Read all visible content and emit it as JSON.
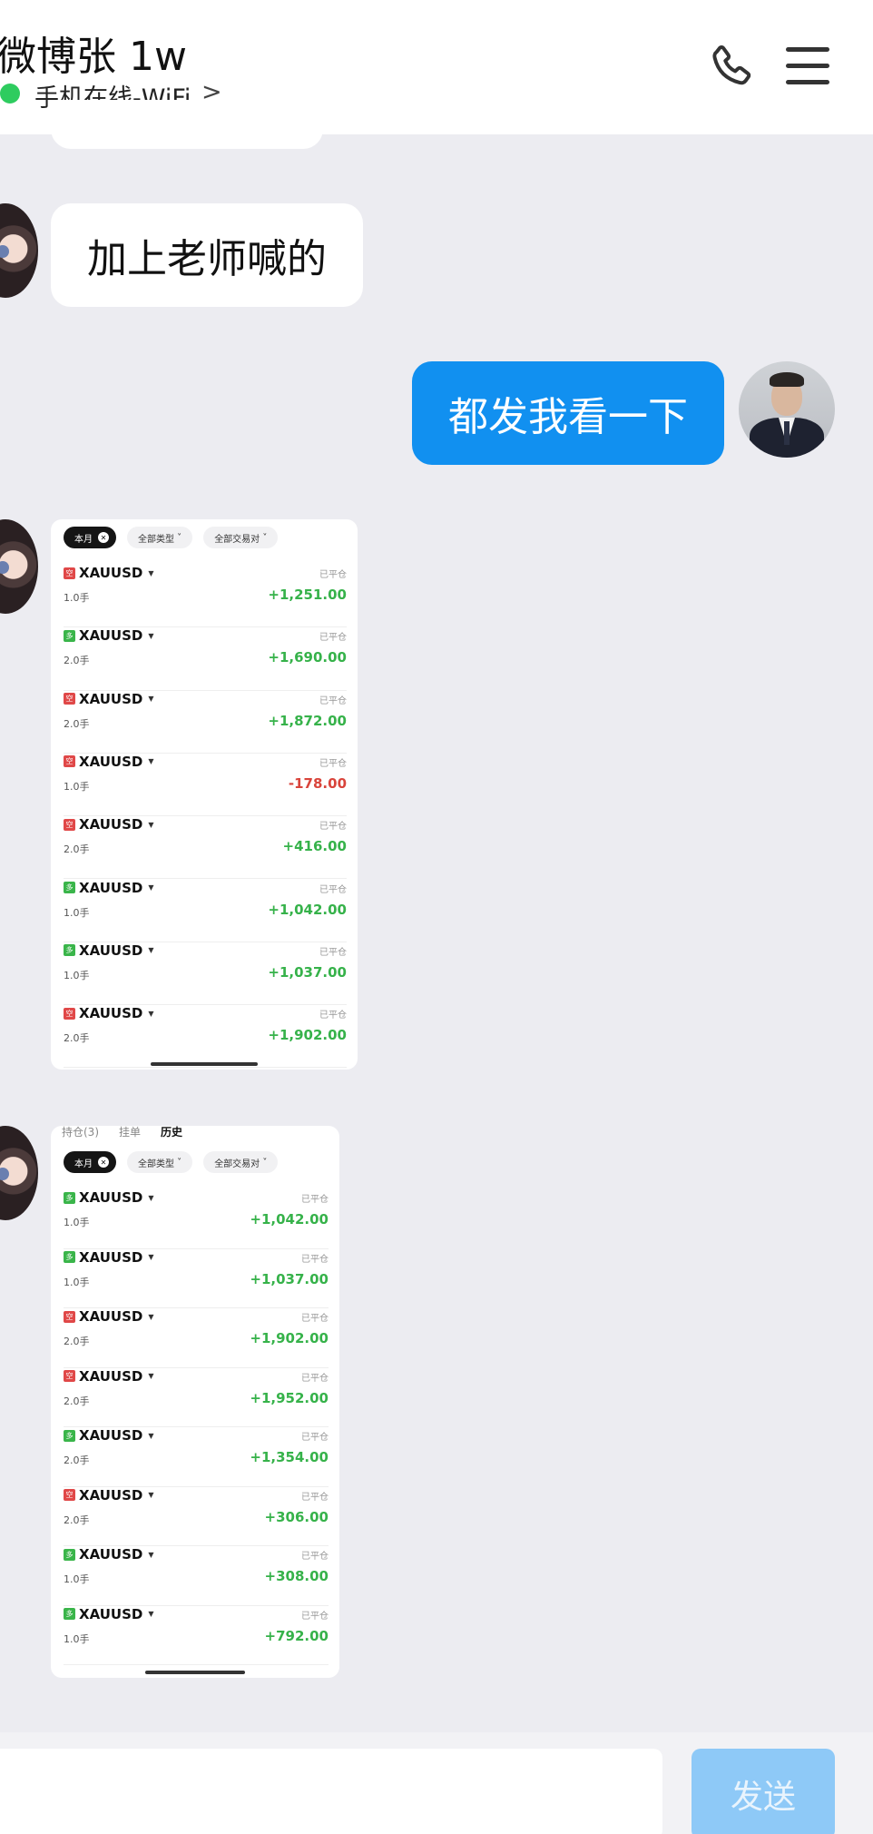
{
  "header": {
    "chat_name": "微博张 1w",
    "status": "手机在线-WiFi",
    "status_chevron": ">",
    "icons": {
      "call": "phone-icon",
      "menu": "menu-icon"
    }
  },
  "messages": {
    "incoming_text": "加上老师喊的",
    "outgoing_text": "都发我看一下"
  },
  "screenshot1": {
    "chips": {
      "month": "本月",
      "type": "全部类型",
      "pair": "全部交易对"
    },
    "trades": [
      {
        "side": "空",
        "symbol": "XAUUSD",
        "lots": "1.0手",
        "status": "已平仓",
        "pnl": "+1,251.00"
      },
      {
        "side": "多",
        "symbol": "XAUUSD",
        "lots": "2.0手",
        "status": "已平仓",
        "pnl": "+1,690.00"
      },
      {
        "side": "空",
        "symbol": "XAUUSD",
        "lots": "2.0手",
        "status": "已平仓",
        "pnl": "+1,872.00"
      },
      {
        "side": "空",
        "symbol": "XAUUSD",
        "lots": "1.0手",
        "status": "已平仓",
        "pnl": "-178.00"
      },
      {
        "side": "空",
        "symbol": "XAUUSD",
        "lots": "2.0手",
        "status": "已平仓",
        "pnl": "+416.00"
      },
      {
        "side": "多",
        "symbol": "XAUUSD",
        "lots": "1.0手",
        "status": "已平仓",
        "pnl": "+1,042.00"
      },
      {
        "side": "多",
        "symbol": "XAUUSD",
        "lots": "1.0手",
        "status": "已平仓",
        "pnl": "+1,037.00"
      },
      {
        "side": "空",
        "symbol": "XAUUSD",
        "lots": "2.0手",
        "status": "已平仓",
        "pnl": "+1,902.00"
      }
    ]
  },
  "screenshot2": {
    "tabs": {
      "positions": "持仓(3)",
      "orders": "挂单",
      "history": "历史"
    },
    "chips": {
      "month": "本月",
      "type": "全部类型",
      "pair": "全部交易对"
    },
    "trades": [
      {
        "side": "多",
        "symbol": "XAUUSD",
        "lots": "1.0手",
        "status": "已平仓",
        "pnl": "+1,042.00"
      },
      {
        "side": "多",
        "symbol": "XAUUSD",
        "lots": "1.0手",
        "status": "已平仓",
        "pnl": "+1,037.00"
      },
      {
        "side": "空",
        "symbol": "XAUUSD",
        "lots": "2.0手",
        "status": "已平仓",
        "pnl": "+1,902.00"
      },
      {
        "side": "空",
        "symbol": "XAUUSD",
        "lots": "2.0手",
        "status": "已平仓",
        "pnl": "+1,952.00"
      },
      {
        "side": "多",
        "symbol": "XAUUSD",
        "lots": "2.0手",
        "status": "已平仓",
        "pnl": "+1,354.00"
      },
      {
        "side": "空",
        "symbol": "XAUUSD",
        "lots": "2.0手",
        "status": "已平仓",
        "pnl": "+306.00"
      },
      {
        "side": "多",
        "symbol": "XAUUSD",
        "lots": "1.0手",
        "status": "已平仓",
        "pnl": "+308.00"
      },
      {
        "side": "多",
        "symbol": "XAUUSD",
        "lots": "1.0手",
        "status": "已平仓",
        "pnl": "+792.00"
      }
    ]
  },
  "composer": {
    "input_value": "",
    "send_label": "发送"
  },
  "colors": {
    "outgoing_bubble": "#1190f0",
    "profit": "#36b24a",
    "loss": "#d9443b",
    "send_button": "#8ec9f7",
    "online": "#2ecc5f"
  }
}
